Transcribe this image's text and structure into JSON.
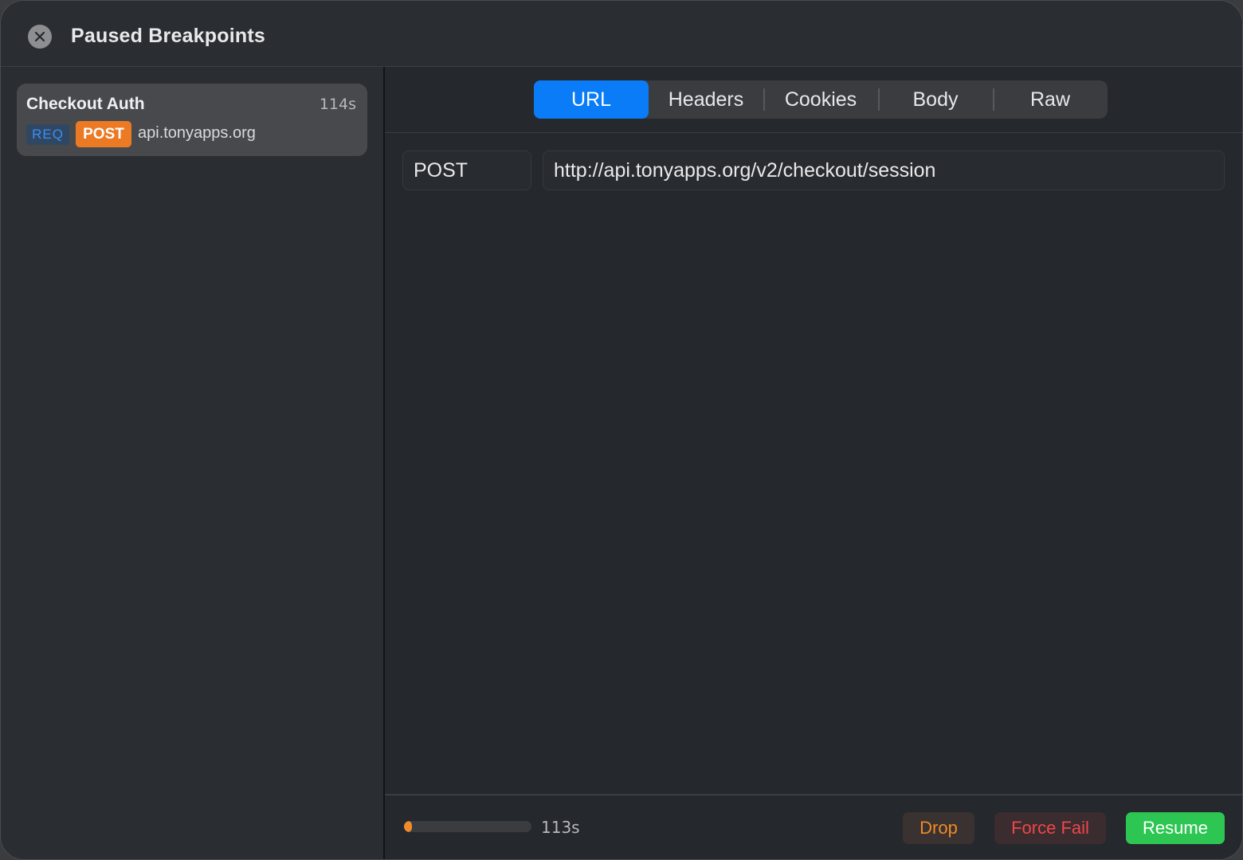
{
  "window": {
    "title": "Paused Breakpoints"
  },
  "sidebar": {
    "items": [
      {
        "name": "Checkout Auth",
        "elapsed": "114s",
        "kind": "REQ",
        "method": "POST",
        "host": "api.tonyapps.org"
      }
    ]
  },
  "tabs": [
    {
      "label": "URL",
      "active": true
    },
    {
      "label": "Headers",
      "active": false
    },
    {
      "label": "Cookies",
      "active": false
    },
    {
      "label": "Body",
      "active": false
    },
    {
      "label": "Raw",
      "active": false
    }
  ],
  "request": {
    "method": "POST",
    "url": "http://api.tonyapps.org/v2/checkout/session"
  },
  "footer": {
    "timeout_progress": 0.05,
    "remaining_label": "113s",
    "drop_label": "Drop",
    "force_fail_label": "Force Fail",
    "resume_label": "Resume"
  },
  "colors": {
    "accent": "#0a7cf7",
    "method_post": "#ec7a24",
    "drop": "#f08a2a",
    "force_fail": "#f0464a",
    "resume": "#2dc653"
  }
}
